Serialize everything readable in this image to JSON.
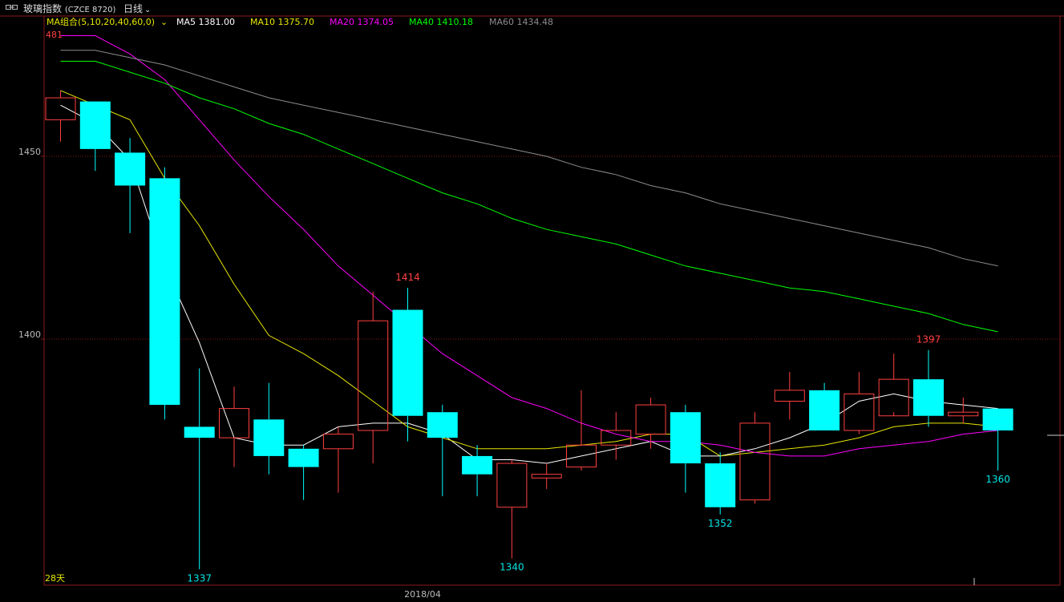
{
  "header": {
    "instrument_name": "玻璃指数",
    "instrument_code": "(CZCE 8720)",
    "period": "日线",
    "period_caret": "⌄"
  },
  "legend": {
    "group_label": "MA组合(5,10,20,40,60,0)",
    "group_caret": "⌄",
    "items": [
      {
        "label": "MA5 1381.00",
        "color": "#ffffff"
      },
      {
        "label": "MA10 1375.70",
        "color": "#e6e600"
      },
      {
        "label": "MA20 1374.05",
        "color": "#ff00ff"
      },
      {
        "label": "MA40 1410.18",
        "color": "#00ff00"
      },
      {
        "label": "MA60 1434.48",
        "color": "#8c8c8c"
      }
    ]
  },
  "colors": {
    "up": "#ff4040",
    "down": "#00ffff",
    "grid": "#8b1a1a",
    "axis": "#8b1a1a",
    "legend_group": "#e6e600",
    "max_label": "#ff4040",
    "min_label": "#00e5e5",
    "axis_text": "#bbbbbb",
    "days_label": "#e6e600"
  },
  "chart_data": {
    "type": "candlestick",
    "y_range": [
      1330,
      1485
    ],
    "y_ticks": [
      "1450",
      "1400"
    ],
    "y_tick_values": [
      1450,
      1400
    ],
    "top_value_label": "481",
    "x_tick_label": "2018/04",
    "days_label": "28天",
    "candles": [
      {
        "o": 1460,
        "h": 1468,
        "l": 1454,
        "c": 1466
      },
      {
        "o": 1465,
        "h": 1460,
        "l": 1446,
        "c": 1452
      },
      {
        "o": 1451,
        "h": 1455,
        "l": 1429,
        "c": 1442
      },
      {
        "o": 1444,
        "h": 1447,
        "l": 1378,
        "c": 1382
      },
      {
        "o": 1376,
        "h": 1392,
        "l": 1337,
        "c": 1373
      },
      {
        "o": 1373,
        "h": 1387,
        "l": 1365,
        "c": 1381
      },
      {
        "o": 1378,
        "h": 1388,
        "l": 1363,
        "c": 1368
      },
      {
        "o": 1370,
        "h": 1371,
        "l": 1356,
        "c": 1365
      },
      {
        "o": 1370,
        "h": 1376,
        "l": 1358,
        "c": 1374
      },
      {
        "o": 1375,
        "h": 1413,
        "l": 1366,
        "c": 1405
      },
      {
        "o": 1408,
        "h": 1414,
        "l": 1372,
        "c": 1379
      },
      {
        "o": 1380,
        "h": 1382,
        "l": 1357,
        "c": 1373
      },
      {
        "o": 1368,
        "h": 1371,
        "l": 1357,
        "c": 1363
      },
      {
        "o": 1354,
        "h": 1367,
        "l": 1340,
        "c": 1366
      },
      {
        "o": 1362,
        "h": 1366,
        "l": 1359,
        "c": 1363
      },
      {
        "o": 1365,
        "h": 1386,
        "l": 1364,
        "c": 1371
      },
      {
        "o": 1371,
        "h": 1380,
        "l": 1367,
        "c": 1375
      },
      {
        "o": 1374,
        "h": 1384,
        "l": 1370,
        "c": 1382
      },
      {
        "o": 1380,
        "h": 1382,
        "l": 1358,
        "c": 1366
      },
      {
        "o": 1366,
        "h": 1369,
        "l": 1352,
        "c": 1354
      },
      {
        "o": 1356,
        "h": 1380,
        "l": 1355,
        "c": 1377
      },
      {
        "o": 1383,
        "h": 1391,
        "l": 1378,
        "c": 1386
      },
      {
        "o": 1386,
        "h": 1388,
        "l": 1375,
        "c": 1375
      },
      {
        "o": 1375,
        "h": 1391,
        "l": 1374,
        "c": 1385
      },
      {
        "o": 1379,
        "h": 1396,
        "l": 1380,
        "c": 1389
      },
      {
        "o": 1389,
        "h": 1397,
        "l": 1376,
        "c": 1379
      },
      {
        "o": 1379,
        "h": 1384,
        "l": 1377,
        "c": 1380
      },
      {
        "o": 1381,
        "h": 1381,
        "l": 1364,
        "c": 1375
      }
    ],
    "point_labels": [
      {
        "index": 10,
        "text": "1414",
        "at": "high",
        "color": "#ff4040"
      },
      {
        "index": 4,
        "text": "1337",
        "at": "low",
        "color": "#00e5e5"
      },
      {
        "index": 13,
        "text": "1340",
        "at": "low",
        "color": "#00e5e5"
      },
      {
        "index": 19,
        "text": "1352",
        "at": "low",
        "color": "#00e5e5"
      },
      {
        "index": 25,
        "text": "1397",
        "at": "high",
        "color": "#ff4040"
      },
      {
        "index": 27,
        "text": "1360",
        "at": "low",
        "color": "#00e5e5"
      }
    ],
    "series": [
      {
        "name": "MA5",
        "color": "#ffffff",
        "values": [
          1464,
          1459,
          1449,
          1420,
          1399,
          1373,
          1371,
          1371,
          1376,
          1377,
          1377,
          1374,
          1367,
          1367,
          1366,
          1368,
          1370,
          1372,
          1368,
          1368,
          1370,
          1373,
          1377,
          1383,
          1385,
          1383,
          1382,
          1381
        ]
      },
      {
        "name": "MA10",
        "color": "#e6e600",
        "values": [
          1468,
          1464,
          1460,
          1444,
          1431,
          1415,
          1401,
          1396,
          1390,
          1383,
          1376,
          1373,
          1370,
          1370,
          1370,
          1371,
          1372,
          1374,
          1374,
          1368,
          1369,
          1370,
          1371,
          1373,
          1376,
          1377,
          1377,
          1376
        ]
      },
      {
        "name": "MA20",
        "color": "#ff00ff",
        "values": [
          1483,
          1483,
          1478,
          1471,
          1460,
          1449,
          1439,
          1430,
          1420,
          1412,
          1404,
          1396,
          1390,
          1384,
          1381,
          1377,
          1374,
          1372,
          1372,
          1371,
          1369,
          1368,
          1368,
          1370,
          1371,
          1372,
          1374,
          1375
        ]
      },
      {
        "name": "MA40",
        "color": "#00ff00",
        "values": [
          1476,
          1476,
          1473,
          1470,
          1466,
          1463,
          1459,
          1456,
          1452,
          1448,
          1444,
          1440,
          1437,
          1433,
          1430,
          1428,
          1426,
          1423,
          1420,
          1418,
          1416,
          1414,
          1413,
          1411,
          1409,
          1407,
          1404,
          1402
        ]
      },
      {
        "name": "MA60",
        "color": "#8c8c8c",
        "values": [
          1479,
          1479,
          1477,
          1475,
          1472,
          1469,
          1466,
          1464,
          1462,
          1460,
          1458,
          1456,
          1454,
          1452,
          1450,
          1447,
          1445,
          1442,
          1440,
          1437,
          1435,
          1433,
          1431,
          1429,
          1427,
          1425,
          1422,
          1420
        ]
      }
    ]
  }
}
